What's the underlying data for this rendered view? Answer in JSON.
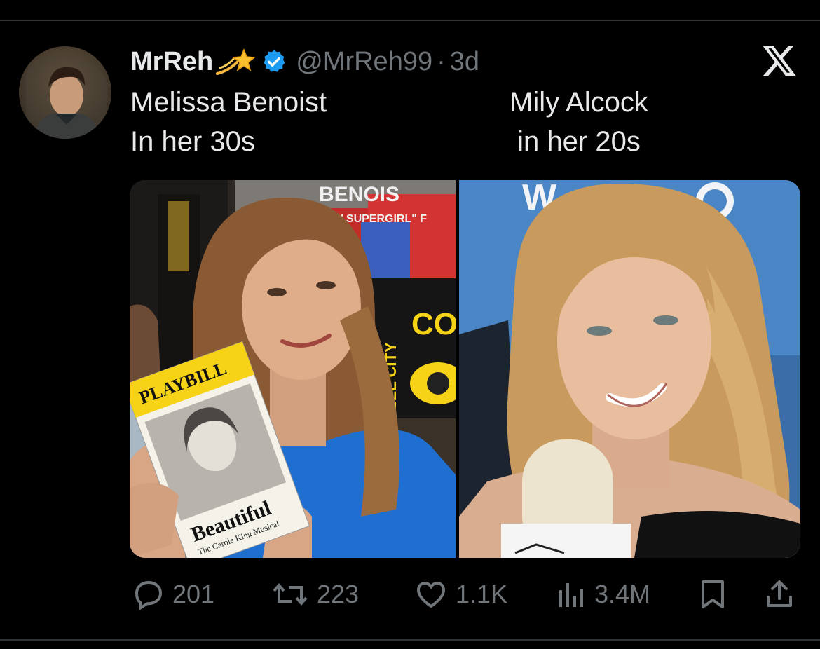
{
  "user": {
    "display_name": "MrReh",
    "handle": "@MrReh99",
    "separator": "·",
    "time": "3d"
  },
  "icons": {
    "emoji": "shooting-star-icon",
    "verified": "verified-badge-icon",
    "platform": "x-logo-icon"
  },
  "post": {
    "left_caption": [
      "Melissa Benoist",
      "In her 30s"
    ],
    "right_caption": [
      "Mily Alcock",
      "in her 20s"
    ],
    "playbill": {
      "brand": "PLAYBILL",
      "title": "Beautiful",
      "subtitle": "The Carole King Musical"
    },
    "booth_banner": "BENOIS",
    "booth_sub": "/ SUPERGIRL\" F",
    "booth_sign": "CO",
    "booth_side": "EEL CITY"
  },
  "stats": {
    "replies": "201",
    "reposts": "223",
    "likes": "1.1K",
    "views": "3.4M"
  },
  "colors": {
    "background": "#000000",
    "text": "#e7e9ea",
    "muted": "#71767b",
    "verified": "#1d9bf0",
    "playbill_yellow": "#f6d317"
  }
}
